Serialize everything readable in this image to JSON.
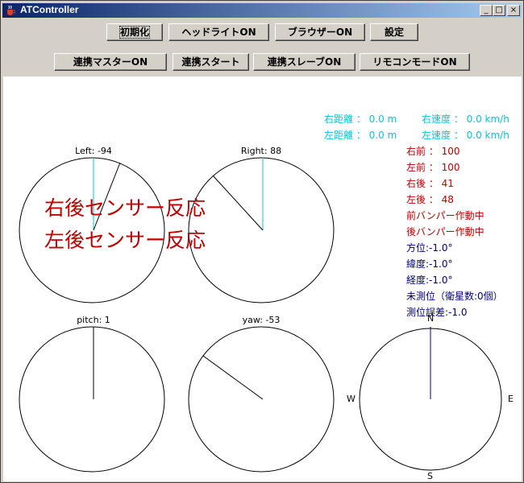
{
  "window": {
    "title": "ATController"
  },
  "titlebar_buttons": {
    "minimize": "_",
    "maximize": "□",
    "close": "×"
  },
  "toolbar": {
    "row1": [
      "初期化",
      "ヘッドライトON",
      "ブラウザーON",
      "設定"
    ],
    "row2": [
      "連携マスターON",
      "連携スタート",
      "連携スレーブON",
      "リモコンモードON"
    ]
  },
  "info": {
    "right_distance": "右距離 ： 0.0 m",
    "right_speed": "右速度 ： 0.0 km/h",
    "left_distance": "左距離 ： 0.0 m",
    "left_speed": "左速度 ： 0.0 km/h",
    "sensors": [
      "右前 ： 100",
      "左前 ： 100",
      "右後 ： 41",
      "左後 ： 48",
      "前バンパー作動中",
      "後バンパー作動中"
    ],
    "gps": [
      "方位:-1.0°",
      "緯度:-1.0°",
      "経度:-1.0°",
      "未測位（衛星数:0個）",
      "測位誤差:-1.0"
    ]
  },
  "warnings": [
    "右後センサー反応",
    "左後センサー反応"
  ],
  "gauges": {
    "left": {
      "label": "Left: -94",
      "value": -94
    },
    "right": {
      "label": "Right: 88",
      "value": 88
    },
    "pitch": {
      "label": "pitch: 1",
      "value": 1
    },
    "yaw": {
      "label": "yaw: -53",
      "value": -53
    }
  },
  "compass": {
    "n": "N",
    "e": "E",
    "s": "S",
    "w": "W"
  },
  "colors": {
    "cyan": "#00c8e0",
    "red": "#c00000",
    "navy": "#000080"
  }
}
